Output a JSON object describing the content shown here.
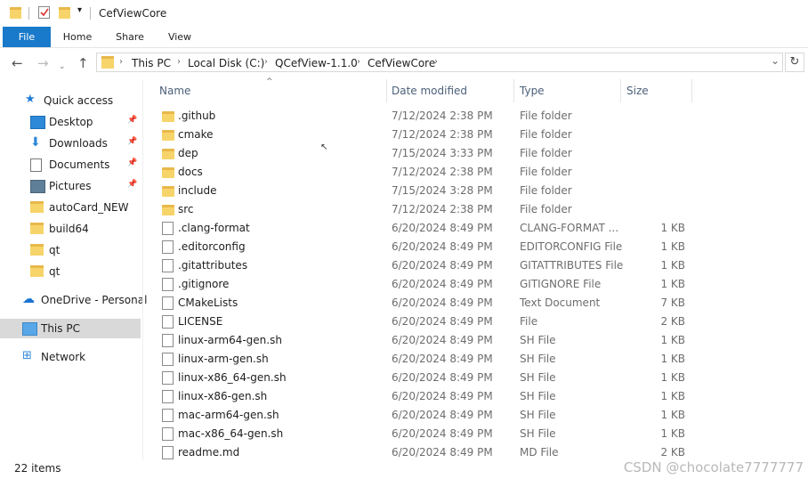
{
  "window": {
    "title": "CefViewCore",
    "quick_access_dropdown": "▾"
  },
  "ribbon": {
    "tabs": [
      "File",
      "Home",
      "Share",
      "View"
    ]
  },
  "address": {
    "crumbs": [
      "This PC",
      "Local Disk (C:)",
      "QCefView-1.1.0",
      "CefViewCore"
    ],
    "refresh_glyph": "↻",
    "dropdown_glyph": "⌄"
  },
  "nav_pane": {
    "items": [
      {
        "label": "Quick access",
        "icon": "star-icon",
        "pinned": false
      },
      {
        "label": "Desktop",
        "icon": "desktop-icon",
        "pinned": true
      },
      {
        "label": "Downloads",
        "icon": "download-icon",
        "pinned": true
      },
      {
        "label": "Documents",
        "icon": "documents-icon",
        "pinned": true
      },
      {
        "label": "Pictures",
        "icon": "pictures-icon",
        "pinned": true
      },
      {
        "label": "autoCard_NEW",
        "icon": "folder-icon",
        "pinned": false
      },
      {
        "label": "build64",
        "icon": "folder-icon",
        "pinned": false
      },
      {
        "label": "qt",
        "icon": "folder-icon",
        "pinned": false
      },
      {
        "label": "qt",
        "icon": "folder-icon",
        "pinned": false
      },
      {
        "label": "OneDrive - Personal",
        "icon": "cloud-icon",
        "pinned": false
      },
      {
        "label": "This PC",
        "icon": "computer-icon",
        "pinned": false,
        "selected": true
      },
      {
        "label": "Network",
        "icon": "network-icon",
        "pinned": false
      }
    ]
  },
  "columns": {
    "name": "Name",
    "date": "Date modified",
    "type": "Type",
    "size": "Size"
  },
  "files": [
    {
      "name": ".github",
      "date": "7/12/2024 2:38 PM",
      "type": "File folder",
      "size": "",
      "kind": "folder"
    },
    {
      "name": "cmake",
      "date": "7/12/2024 2:38 PM",
      "type": "File folder",
      "size": "",
      "kind": "folder"
    },
    {
      "name": "dep",
      "date": "7/15/2024 3:33 PM",
      "type": "File folder",
      "size": "",
      "kind": "folder"
    },
    {
      "name": "docs",
      "date": "7/12/2024 2:38 PM",
      "type": "File folder",
      "size": "",
      "kind": "folder"
    },
    {
      "name": "include",
      "date": "7/15/2024 3:28 PM",
      "type": "File folder",
      "size": "",
      "kind": "folder"
    },
    {
      "name": "src",
      "date": "7/12/2024 2:38 PM",
      "type": "File folder",
      "size": "",
      "kind": "folder"
    },
    {
      "name": ".clang-format",
      "date": "6/20/2024 8:49 PM",
      "type": "CLANG-FORMAT ...",
      "size": "1 KB",
      "kind": "file"
    },
    {
      "name": ".editorconfig",
      "date": "6/20/2024 8:49 PM",
      "type": "EDITORCONFIG File",
      "size": "1 KB",
      "kind": "file"
    },
    {
      "name": ".gitattributes",
      "date": "6/20/2024 8:49 PM",
      "type": "GITATTRIBUTES File",
      "size": "1 KB",
      "kind": "file"
    },
    {
      "name": ".gitignore",
      "date": "6/20/2024 8:49 PM",
      "type": "GITIGNORE File",
      "size": "1 KB",
      "kind": "file"
    },
    {
      "name": "CMakeLists",
      "date": "6/20/2024 8:49 PM",
      "type": "Text Document",
      "size": "7 KB",
      "kind": "file"
    },
    {
      "name": "LICENSE",
      "date": "6/20/2024 8:49 PM",
      "type": "File",
      "size": "2 KB",
      "kind": "file"
    },
    {
      "name": "linux-arm64-gen.sh",
      "date": "6/20/2024 8:49 PM",
      "type": "SH File",
      "size": "1 KB",
      "kind": "file"
    },
    {
      "name": "linux-arm-gen.sh",
      "date": "6/20/2024 8:49 PM",
      "type": "SH File",
      "size": "1 KB",
      "kind": "file"
    },
    {
      "name": "linux-x86_64-gen.sh",
      "date": "6/20/2024 8:49 PM",
      "type": "SH File",
      "size": "1 KB",
      "kind": "file"
    },
    {
      "name": "linux-x86-gen.sh",
      "date": "6/20/2024 8:49 PM",
      "type": "SH File",
      "size": "1 KB",
      "kind": "file"
    },
    {
      "name": "mac-arm64-gen.sh",
      "date": "6/20/2024 8:49 PM",
      "type": "SH File",
      "size": "1 KB",
      "kind": "file"
    },
    {
      "name": "mac-x86_64-gen.sh",
      "date": "6/20/2024 8:49 PM",
      "type": "SH File",
      "size": "1 KB",
      "kind": "file"
    },
    {
      "name": "readme.md",
      "date": "6/20/2024 8:49 PM",
      "type": "MD File",
      "size": "2 KB",
      "kind": "file"
    }
  ],
  "status": {
    "item_count": "22 items",
    "watermark": "CSDN @chocolate7777777"
  },
  "colors": {
    "file_tab": "#1979ca",
    "folder": "#f7d46a",
    "selected_nav": "#d9d9d9",
    "header_text": "#4c607a"
  }
}
